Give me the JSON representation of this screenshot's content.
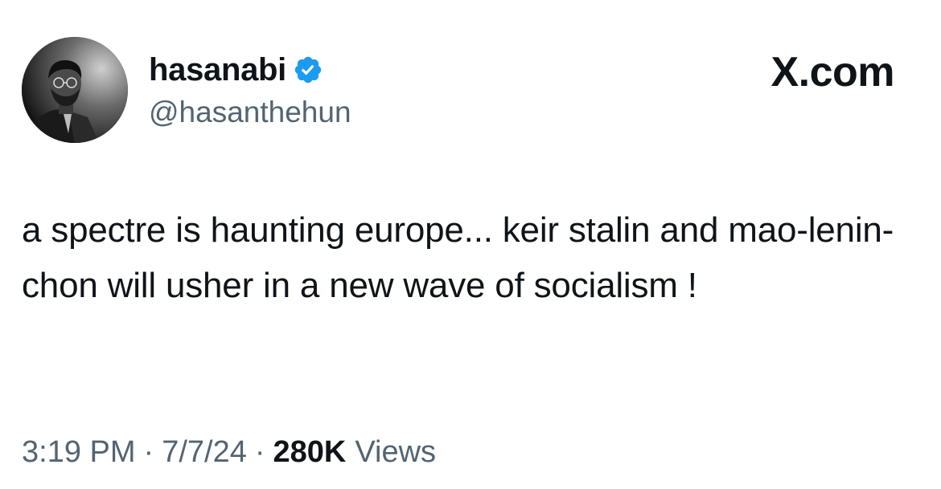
{
  "tweet": {
    "display_name": "hasanabi",
    "handle": "@hasanthehun",
    "verified": true,
    "verified_color": "#1d9bf0",
    "avatar": "profile-photo",
    "brand": "X.com",
    "text": "a spectre is haunting europe... keir stalin and mao-lenin-chon will usher in a new wave of socialism !",
    "time": "3:19 PM",
    "separator": "·",
    "date": "7/7/24",
    "views_count": "280K",
    "views_label": "Views"
  },
  "colors": {
    "primary_text": "#0f1419",
    "secondary_text": "#536471",
    "background": "#ffffff"
  }
}
